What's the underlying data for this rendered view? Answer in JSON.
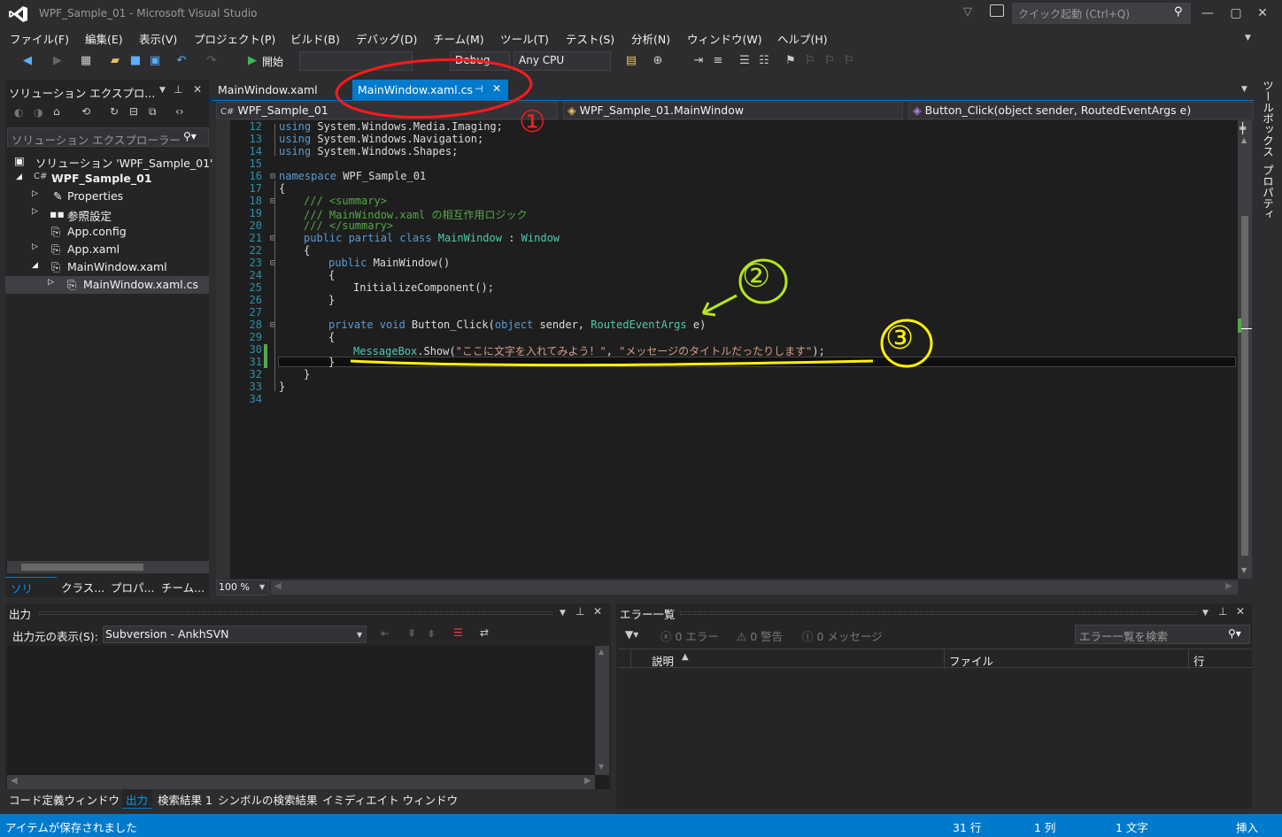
{
  "window": {
    "title": "WPF_Sample_01 - Microsoft Visual Studio",
    "quick_launch_placeholder": "クイック起動 (Ctrl+Q)"
  },
  "menu": [
    "ファイル(F)",
    "編集(E)",
    "表示(V)",
    "プロジェクト(P)",
    "ビルド(B)",
    "デバッグ(D)",
    "チーム(M)",
    "ツール(T)",
    "テスト(S)",
    "分析(N)",
    "ウィンドウ(W)",
    "ヘルプ(H)"
  ],
  "toolbar": {
    "start_label": "開始",
    "config": "Debug",
    "platform": "Any CPU"
  },
  "solution_explorer": {
    "title": "ソリューション エクスプロ...",
    "search_placeholder": "ソリューション エクスプローラー",
    "nodes": [
      {
        "label": "ソリューション 'WPF_Sample_01'"
      },
      {
        "label": "WPF_Sample_01"
      },
      {
        "label": "Properties"
      },
      {
        "label": "参照設定"
      },
      {
        "label": "App.config"
      },
      {
        "label": "App.xaml"
      },
      {
        "label": "MainWindow.xaml"
      },
      {
        "label": "MainWindow.xaml.cs"
      }
    ],
    "bottom_tabs": [
      "ソリュ...",
      "クラス...",
      "プロパ...",
      "チーム..."
    ]
  },
  "editor": {
    "tabs": [
      "MainWindow.xaml",
      "MainWindow.xaml.cs"
    ],
    "nav": [
      "WPF_Sample_01",
      "WPF_Sample_01.MainWindow",
      "Button_Click(object sender, RoutedEventArgs e)"
    ],
    "zoom": "100 %",
    "line_numbers": [
      "12",
      "13",
      "14",
      "15",
      "16",
      "17",
      "18",
      "19",
      "20",
      "21",
      "22",
      "23",
      "24",
      "25",
      "26",
      "27",
      "28",
      "29",
      "30",
      "31",
      "32",
      "33",
      "34"
    ],
    "code": {
      "l12": "using System.Windows.Media.Imaging;",
      "l13": "using System.Windows.Navigation;",
      "l14": "using System.Windows.Shapes;",
      "l16_kw": "namespace",
      "l16_name": " WPF_Sample_01",
      "l17": "{",
      "l18": "/// <summary>",
      "l19": "/// MainWindow.xaml の相互作用ロジック",
      "l20": "/// </summary>",
      "l21_kw": "public partial class",
      "l21_ty": "MainWindow",
      "l21_sep": " : ",
      "l21_base": "Window",
      "l22": "{",
      "l23_kw": "public",
      "l23_rest": " MainWindow()",
      "l24": "{",
      "l25": "InitializeComponent();",
      "l26": "}",
      "l28_kw": "private void",
      "l28_name": " Button_Click(",
      "l28_obj": "object",
      "l28_sender": " sender, ",
      "l28_ty": "RoutedEventArgs",
      "l28_e": " e)",
      "l29": "{",
      "l30_ty": "MessageBox",
      "l30_call": ".Show(",
      "l30_str1": "\"ここに文字を入れてみよう！\"",
      "l30_sep": ", ",
      "l30_str2": "\"メッセージのタイトルだったりします\"",
      "l30_end": ");",
      "l31": "}",
      "l32": "}",
      "l33": "}"
    },
    "annotations": [
      "①",
      "②",
      "③"
    ]
  },
  "right_sidebar": [
    "ツールボックス",
    "プロパティ"
  ],
  "output": {
    "title": "出力",
    "source_label": "出力元の表示(S):",
    "source_value": "Subversion - AnkhSVN"
  },
  "error_list": {
    "title": "エラー一覧",
    "errors": "0 エラー",
    "warnings": "0 警告",
    "messages": "0 メッセージ",
    "search_placeholder": "エラー一覧を検索",
    "columns": [
      "説明",
      "ファイル",
      "行"
    ]
  },
  "bottom_tabs": [
    "コード定義ウィンドウ",
    "出力",
    "検索結果 1",
    "シンボルの検索結果",
    "イミディエイト ウィンドウ"
  ],
  "status": {
    "message": "アイテムが保存されました",
    "line": "31 行",
    "col": "1 列",
    "char": "1 文字",
    "mode": "挿入"
  },
  "colors": {
    "accent": "#007acc",
    "annotation_red": "#ff1a1a",
    "annotation_green": "#b5e61d",
    "annotation_yellow": "#fff200"
  }
}
